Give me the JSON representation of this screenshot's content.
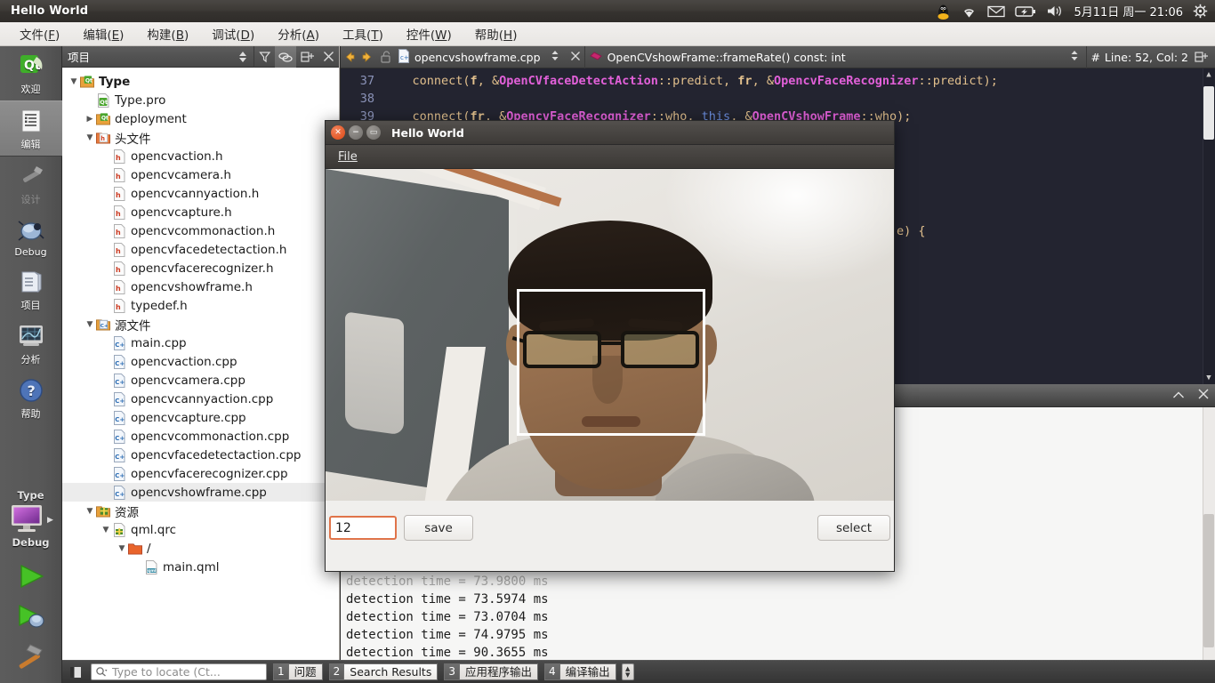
{
  "top_panel": {
    "window_title": "Hello World",
    "indicators": [
      "linux-penguin-icon",
      "wifi-icon",
      "mail-icon",
      "battery-icon",
      "volume-icon"
    ],
    "clock": "5月11日 周一 21:06",
    "gear": "gear-icon"
  },
  "menubar": {
    "items": [
      {
        "label": "文件",
        "accel": "F"
      },
      {
        "label": "编辑",
        "accel": "E"
      },
      {
        "label": "构建",
        "accel": "B"
      },
      {
        "label": "调试",
        "accel": "D"
      },
      {
        "label": "分析",
        "accel": "A"
      },
      {
        "label": "工具",
        "accel": "T"
      },
      {
        "label": "控件",
        "accel": "W"
      },
      {
        "label": "帮助",
        "accel": "H"
      }
    ]
  },
  "modebar": {
    "modes": [
      {
        "label": "欢迎",
        "icon": "qt-logo-icon",
        "state": "normal"
      },
      {
        "label": "编辑",
        "icon": "edit-document-icon",
        "state": "active"
      },
      {
        "label": "设计",
        "icon": "design-brush-icon",
        "state": "disabled"
      },
      {
        "label": "Debug",
        "icon": "debug-bug-icon",
        "state": "normal"
      },
      {
        "label": "项目",
        "icon": "projects-folder-icon",
        "state": "normal"
      },
      {
        "label": "分析",
        "icon": "analyze-monitor-icon",
        "state": "normal"
      },
      {
        "label": "帮助",
        "icon": "help-question-icon",
        "state": "normal"
      }
    ],
    "kit_label": "Type",
    "kit_config": "Debug",
    "kit_icon": "target-monitor-icon",
    "actions": [
      {
        "name": "run-button",
        "icon": "green-play-icon"
      },
      {
        "name": "debug-button",
        "icon": "play-bug-icon"
      },
      {
        "name": "build-button",
        "icon": "hammer-icon"
      }
    ]
  },
  "project_dock": {
    "title": "项目",
    "header_icons": [
      "sort-updown-icon",
      "filter-icon",
      "link-sync-icon",
      "split-add-icon",
      "close-icon"
    ],
    "tree": [
      {
        "depth": 0,
        "arrow": "down",
        "icon": "qt-project-icon",
        "label": "Type",
        "bold": true
      },
      {
        "depth": 1,
        "arrow": "none",
        "icon": "qt-pro-file-icon",
        "label": "Type.pro"
      },
      {
        "depth": 1,
        "arrow": "right",
        "icon": "qt-project-icon",
        "label": "deployment"
      },
      {
        "depth": 1,
        "arrow": "down",
        "icon": "h-folder-icon",
        "label": "头文件"
      },
      {
        "depth": 2,
        "arrow": "none",
        "icon": "h-file-icon",
        "label": "opencvaction.h"
      },
      {
        "depth": 2,
        "arrow": "none",
        "icon": "h-file-icon",
        "label": "opencvcamera.h"
      },
      {
        "depth": 2,
        "arrow": "none",
        "icon": "h-file-icon",
        "label": "opencvcannyaction.h"
      },
      {
        "depth": 2,
        "arrow": "none",
        "icon": "h-file-icon",
        "label": "opencvcapture.h"
      },
      {
        "depth": 2,
        "arrow": "none",
        "icon": "h-file-icon",
        "label": "opencvcommonaction.h"
      },
      {
        "depth": 2,
        "arrow": "none",
        "icon": "h-file-icon",
        "label": "opencvfacedetectaction.h"
      },
      {
        "depth": 2,
        "arrow": "none",
        "icon": "h-file-icon",
        "label": "opencvfacerecognizer.h"
      },
      {
        "depth": 2,
        "arrow": "none",
        "icon": "h-file-icon",
        "label": "opencvshowframe.h"
      },
      {
        "depth": 2,
        "arrow": "none",
        "icon": "h-file-icon",
        "label": "typedef.h"
      },
      {
        "depth": 1,
        "arrow": "down",
        "icon": "cpp-folder-icon",
        "label": "源文件"
      },
      {
        "depth": 2,
        "arrow": "none",
        "icon": "cpp-file-icon",
        "label": "main.cpp"
      },
      {
        "depth": 2,
        "arrow": "none",
        "icon": "cpp-file-icon",
        "label": "opencvaction.cpp"
      },
      {
        "depth": 2,
        "arrow": "none",
        "icon": "cpp-file-icon",
        "label": "opencvcamera.cpp"
      },
      {
        "depth": 2,
        "arrow": "none",
        "icon": "cpp-file-icon",
        "label": "opencvcannyaction.cpp"
      },
      {
        "depth": 2,
        "arrow": "none",
        "icon": "cpp-file-icon",
        "label": "opencvcapture.cpp"
      },
      {
        "depth": 2,
        "arrow": "none",
        "icon": "cpp-file-icon",
        "label": "opencvcommonaction.cpp"
      },
      {
        "depth": 2,
        "arrow": "none",
        "icon": "cpp-file-icon",
        "label": "opencvfacedetectaction.cpp"
      },
      {
        "depth": 2,
        "arrow": "none",
        "icon": "cpp-file-icon",
        "label": "opencvfacerecognizer.cpp"
      },
      {
        "depth": 2,
        "arrow": "none",
        "icon": "cpp-file-icon",
        "label": "opencvshowframe.cpp",
        "selected": true
      },
      {
        "depth": 1,
        "arrow": "down",
        "icon": "resource-folder-icon",
        "label": "资源"
      },
      {
        "depth": 2,
        "arrow": "down",
        "icon": "qrc-file-icon",
        "label": "qml.qrc"
      },
      {
        "depth": 3,
        "arrow": "down",
        "icon": "plain-folder-icon",
        "label": "/"
      },
      {
        "depth": 4,
        "arrow": "none",
        "icon": "qml-file-icon",
        "label": "main.qml"
      }
    ]
  },
  "editor": {
    "nav_back": "back-arrow-icon",
    "nav_forward": "forward-arrow-icon",
    "lock": "unlocked-icon",
    "file_icon": "cpp-file-icon",
    "file_name": "opencvshowframe.cpp",
    "file_close": "close-icon",
    "symbol_icon": "method-icon",
    "symbol_name": "OpenCVshowFrame::frameRate() const: int",
    "line_col_icon": "#",
    "line_col": "Line: 52, Col: 2",
    "split_icon": "split-editor-icon",
    "lines": [
      {
        "num": "37",
        "tokens": [
          {
            "t": "    connect(",
            "c": "plain"
          },
          {
            "t": "f",
            "c": "bold-plain"
          },
          {
            "t": ", &",
            "c": "plain"
          },
          {
            "t": "OpenCVfaceDetectAction",
            "c": "type"
          },
          {
            "t": "::predict, ",
            "c": "plain"
          },
          {
            "t": "fr",
            "c": "bold-plain"
          },
          {
            "t": ", &",
            "c": "plain"
          },
          {
            "t": "OpencvFaceRecognizer",
            "c": "type"
          },
          {
            "t": "::predict);",
            "c": "plain"
          }
        ]
      },
      {
        "num": "38",
        "tokens": []
      },
      {
        "num": "39",
        "tokens": [
          {
            "t": "    connect(",
            "c": "plain"
          },
          {
            "t": "fr",
            "c": "bold-plain"
          },
          {
            "t": ", &",
            "c": "plain"
          },
          {
            "t": "OpencvFaceRecognizer",
            "c": "type"
          },
          {
            "t": "::who, ",
            "c": "plain"
          },
          {
            "t": "this",
            "c": "keyword"
          },
          {
            "t": ", &",
            "c": "plain"
          },
          {
            "t": "OpenCVshowFrame",
            "c": "type"
          },
          {
            "t": "::who);",
            "c": "plain"
          }
        ]
      }
    ],
    "hidden_fragment": "e) {"
  },
  "output_pane": {
    "collapse_icon": "chevron-up-icon",
    "close_icon": "close-icon",
    "lines": [
      "detection time = 73.9800 ms",
      "detection time = 73.5974 ms",
      "detection time = 73.0704 ms",
      "detection time = 74.9795 ms",
      "detection time = 90.3655 ms"
    ]
  },
  "statusbar": {
    "sidebar_toggle": "sidebar-toggle-icon",
    "locator_icon": "search-icon",
    "locator_placeholder": "Type to locate (Ct...",
    "tabs": [
      {
        "num": "1",
        "label": "问题",
        "active": false
      },
      {
        "num": "2",
        "label": "Search Results",
        "active": true
      },
      {
        "num": "3",
        "label": "应用程序输出",
        "active": false
      },
      {
        "num": "4",
        "label": "编译输出",
        "active": false
      }
    ],
    "spinner": "updown-spinner-icon"
  },
  "dialog": {
    "title": "Hello World",
    "buttons": {
      "close": "close-icon",
      "minimize": "minimize-icon",
      "maximize": "maximize-icon"
    },
    "menu": [
      {
        "label": "File",
        "accel": "F"
      }
    ],
    "video": {
      "overlay": "face-detection-box"
    },
    "number_value": "12",
    "save_label": "save",
    "select_label": "select"
  },
  "colors": {
    "accent_orange": "#dd4814",
    "editor_bg": "#232430",
    "type_pink": "#e260d9",
    "keyword_blue": "#6c8fe0",
    "panel_dark": "#3d3a37"
  }
}
